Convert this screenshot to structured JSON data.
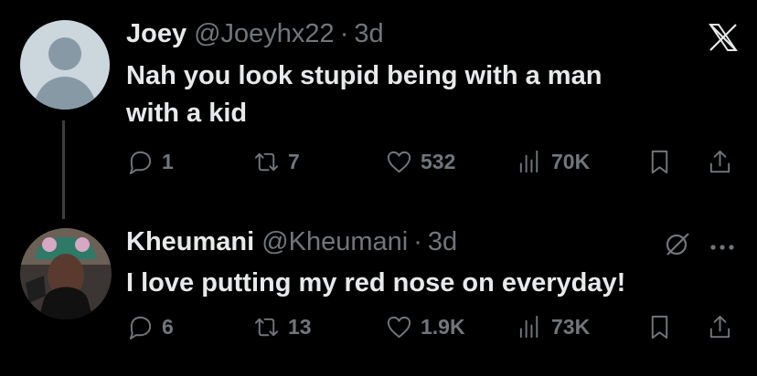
{
  "tweets": [
    {
      "name": "Joey",
      "handle": "@Joeyhx22",
      "separator": "·",
      "time": "3d",
      "text_lines": [
        "Nah you look stupid being with a man",
        "with a kid"
      ],
      "replies": "1",
      "reposts": "7",
      "likes": "532",
      "views": "70K",
      "corner_icon": "x-logo-icon"
    },
    {
      "name": "Kheumani",
      "handle": "@Kheumani",
      "separator": "·",
      "time": "3d",
      "text_lines": [
        "I love putting my red nose on everyday!"
      ],
      "replies": "6",
      "reposts": "13",
      "likes": "1.9K",
      "views": "73K",
      "corner_icons": [
        "grok-icon",
        "more-icon"
      ]
    }
  ]
}
